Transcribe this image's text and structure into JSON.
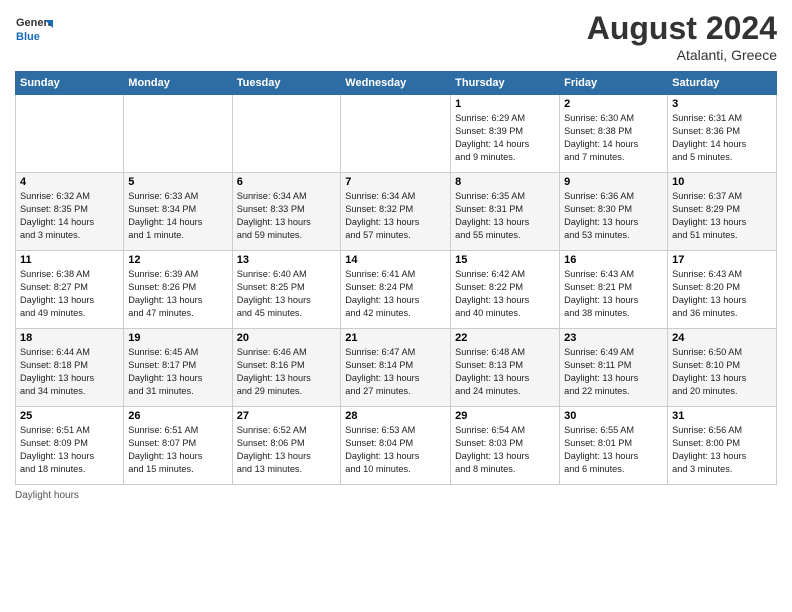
{
  "header": {
    "logo_general": "General",
    "logo_blue": "Blue",
    "month_year": "August 2024",
    "location": "Atalanti, Greece"
  },
  "weekdays": [
    "Sunday",
    "Monday",
    "Tuesday",
    "Wednesday",
    "Thursday",
    "Friday",
    "Saturday"
  ],
  "footer": {
    "label": "Daylight hours"
  },
  "weeks": [
    [
      {
        "day": "",
        "info": ""
      },
      {
        "day": "",
        "info": ""
      },
      {
        "day": "",
        "info": ""
      },
      {
        "day": "",
        "info": ""
      },
      {
        "day": "1",
        "info": "Sunrise: 6:29 AM\nSunset: 8:39 PM\nDaylight: 14 hours\nand 9 minutes."
      },
      {
        "day": "2",
        "info": "Sunrise: 6:30 AM\nSunset: 8:38 PM\nDaylight: 14 hours\nand 7 minutes."
      },
      {
        "day": "3",
        "info": "Sunrise: 6:31 AM\nSunset: 8:36 PM\nDaylight: 14 hours\nand 5 minutes."
      }
    ],
    [
      {
        "day": "4",
        "info": "Sunrise: 6:32 AM\nSunset: 8:35 PM\nDaylight: 14 hours\nand 3 minutes."
      },
      {
        "day": "5",
        "info": "Sunrise: 6:33 AM\nSunset: 8:34 PM\nDaylight: 14 hours\nand 1 minute."
      },
      {
        "day": "6",
        "info": "Sunrise: 6:34 AM\nSunset: 8:33 PM\nDaylight: 13 hours\nand 59 minutes."
      },
      {
        "day": "7",
        "info": "Sunrise: 6:34 AM\nSunset: 8:32 PM\nDaylight: 13 hours\nand 57 minutes."
      },
      {
        "day": "8",
        "info": "Sunrise: 6:35 AM\nSunset: 8:31 PM\nDaylight: 13 hours\nand 55 minutes."
      },
      {
        "day": "9",
        "info": "Sunrise: 6:36 AM\nSunset: 8:30 PM\nDaylight: 13 hours\nand 53 minutes."
      },
      {
        "day": "10",
        "info": "Sunrise: 6:37 AM\nSunset: 8:29 PM\nDaylight: 13 hours\nand 51 minutes."
      }
    ],
    [
      {
        "day": "11",
        "info": "Sunrise: 6:38 AM\nSunset: 8:27 PM\nDaylight: 13 hours\nand 49 minutes."
      },
      {
        "day": "12",
        "info": "Sunrise: 6:39 AM\nSunset: 8:26 PM\nDaylight: 13 hours\nand 47 minutes."
      },
      {
        "day": "13",
        "info": "Sunrise: 6:40 AM\nSunset: 8:25 PM\nDaylight: 13 hours\nand 45 minutes."
      },
      {
        "day": "14",
        "info": "Sunrise: 6:41 AM\nSunset: 8:24 PM\nDaylight: 13 hours\nand 42 minutes."
      },
      {
        "day": "15",
        "info": "Sunrise: 6:42 AM\nSunset: 8:22 PM\nDaylight: 13 hours\nand 40 minutes."
      },
      {
        "day": "16",
        "info": "Sunrise: 6:43 AM\nSunset: 8:21 PM\nDaylight: 13 hours\nand 38 minutes."
      },
      {
        "day": "17",
        "info": "Sunrise: 6:43 AM\nSunset: 8:20 PM\nDaylight: 13 hours\nand 36 minutes."
      }
    ],
    [
      {
        "day": "18",
        "info": "Sunrise: 6:44 AM\nSunset: 8:18 PM\nDaylight: 13 hours\nand 34 minutes."
      },
      {
        "day": "19",
        "info": "Sunrise: 6:45 AM\nSunset: 8:17 PM\nDaylight: 13 hours\nand 31 minutes."
      },
      {
        "day": "20",
        "info": "Sunrise: 6:46 AM\nSunset: 8:16 PM\nDaylight: 13 hours\nand 29 minutes."
      },
      {
        "day": "21",
        "info": "Sunrise: 6:47 AM\nSunset: 8:14 PM\nDaylight: 13 hours\nand 27 minutes."
      },
      {
        "day": "22",
        "info": "Sunrise: 6:48 AM\nSunset: 8:13 PM\nDaylight: 13 hours\nand 24 minutes."
      },
      {
        "day": "23",
        "info": "Sunrise: 6:49 AM\nSunset: 8:11 PM\nDaylight: 13 hours\nand 22 minutes."
      },
      {
        "day": "24",
        "info": "Sunrise: 6:50 AM\nSunset: 8:10 PM\nDaylight: 13 hours\nand 20 minutes."
      }
    ],
    [
      {
        "day": "25",
        "info": "Sunrise: 6:51 AM\nSunset: 8:09 PM\nDaylight: 13 hours\nand 18 minutes."
      },
      {
        "day": "26",
        "info": "Sunrise: 6:51 AM\nSunset: 8:07 PM\nDaylight: 13 hours\nand 15 minutes."
      },
      {
        "day": "27",
        "info": "Sunrise: 6:52 AM\nSunset: 8:06 PM\nDaylight: 13 hours\nand 13 minutes."
      },
      {
        "day": "28",
        "info": "Sunrise: 6:53 AM\nSunset: 8:04 PM\nDaylight: 13 hours\nand 10 minutes."
      },
      {
        "day": "29",
        "info": "Sunrise: 6:54 AM\nSunset: 8:03 PM\nDaylight: 13 hours\nand 8 minutes."
      },
      {
        "day": "30",
        "info": "Sunrise: 6:55 AM\nSunset: 8:01 PM\nDaylight: 13 hours\nand 6 minutes."
      },
      {
        "day": "31",
        "info": "Sunrise: 6:56 AM\nSunset: 8:00 PM\nDaylight: 13 hours\nand 3 minutes."
      }
    ]
  ]
}
